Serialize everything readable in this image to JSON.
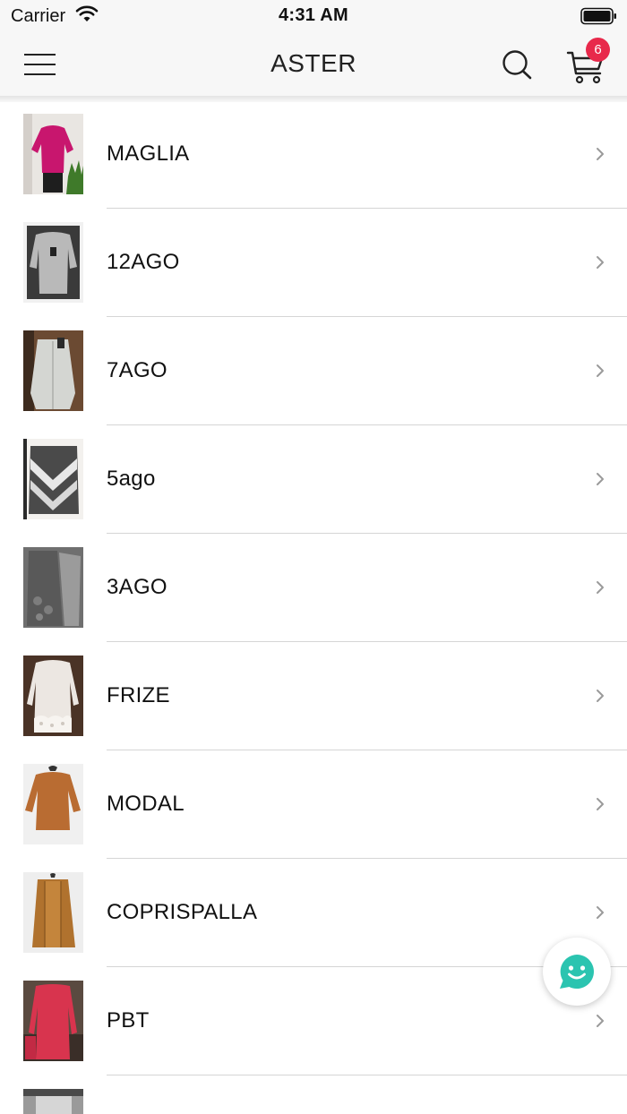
{
  "status_bar": {
    "carrier": "Carrier",
    "time": "4:31 AM"
  },
  "nav": {
    "title": "ASTER",
    "cart_count": "6"
  },
  "colors": {
    "badge": "#e8294b",
    "chat_accent": "#2bc4b0",
    "nav_background": "#f7f7f7",
    "divider": "#d5d5d5"
  },
  "icons": {
    "menu": "hamburger-icon",
    "search": "search-icon",
    "cart": "cart-icon",
    "row_arrow": "chevron-right-icon",
    "chat": "chat-smile-icon"
  },
  "categories": [
    {
      "label": "MAGLIA",
      "thumb": "pink-sweater"
    },
    {
      "label": "12AGO",
      "thumb": "grey-sweater"
    },
    {
      "label": "7AGO",
      "thumb": "light-cardigan"
    },
    {
      "label": "5ago",
      "thumb": "chevron-sweater"
    },
    {
      "label": "3AGO",
      "thumb": "dark-knit"
    },
    {
      "label": "FRIZE",
      "thumb": "white-lace-top"
    },
    {
      "label": "MODAL",
      "thumb": "camel-top"
    },
    {
      "label": "COPRISPALLA",
      "thumb": "camel-shrug"
    },
    {
      "label": "PBT",
      "thumb": "red-top"
    }
  ]
}
